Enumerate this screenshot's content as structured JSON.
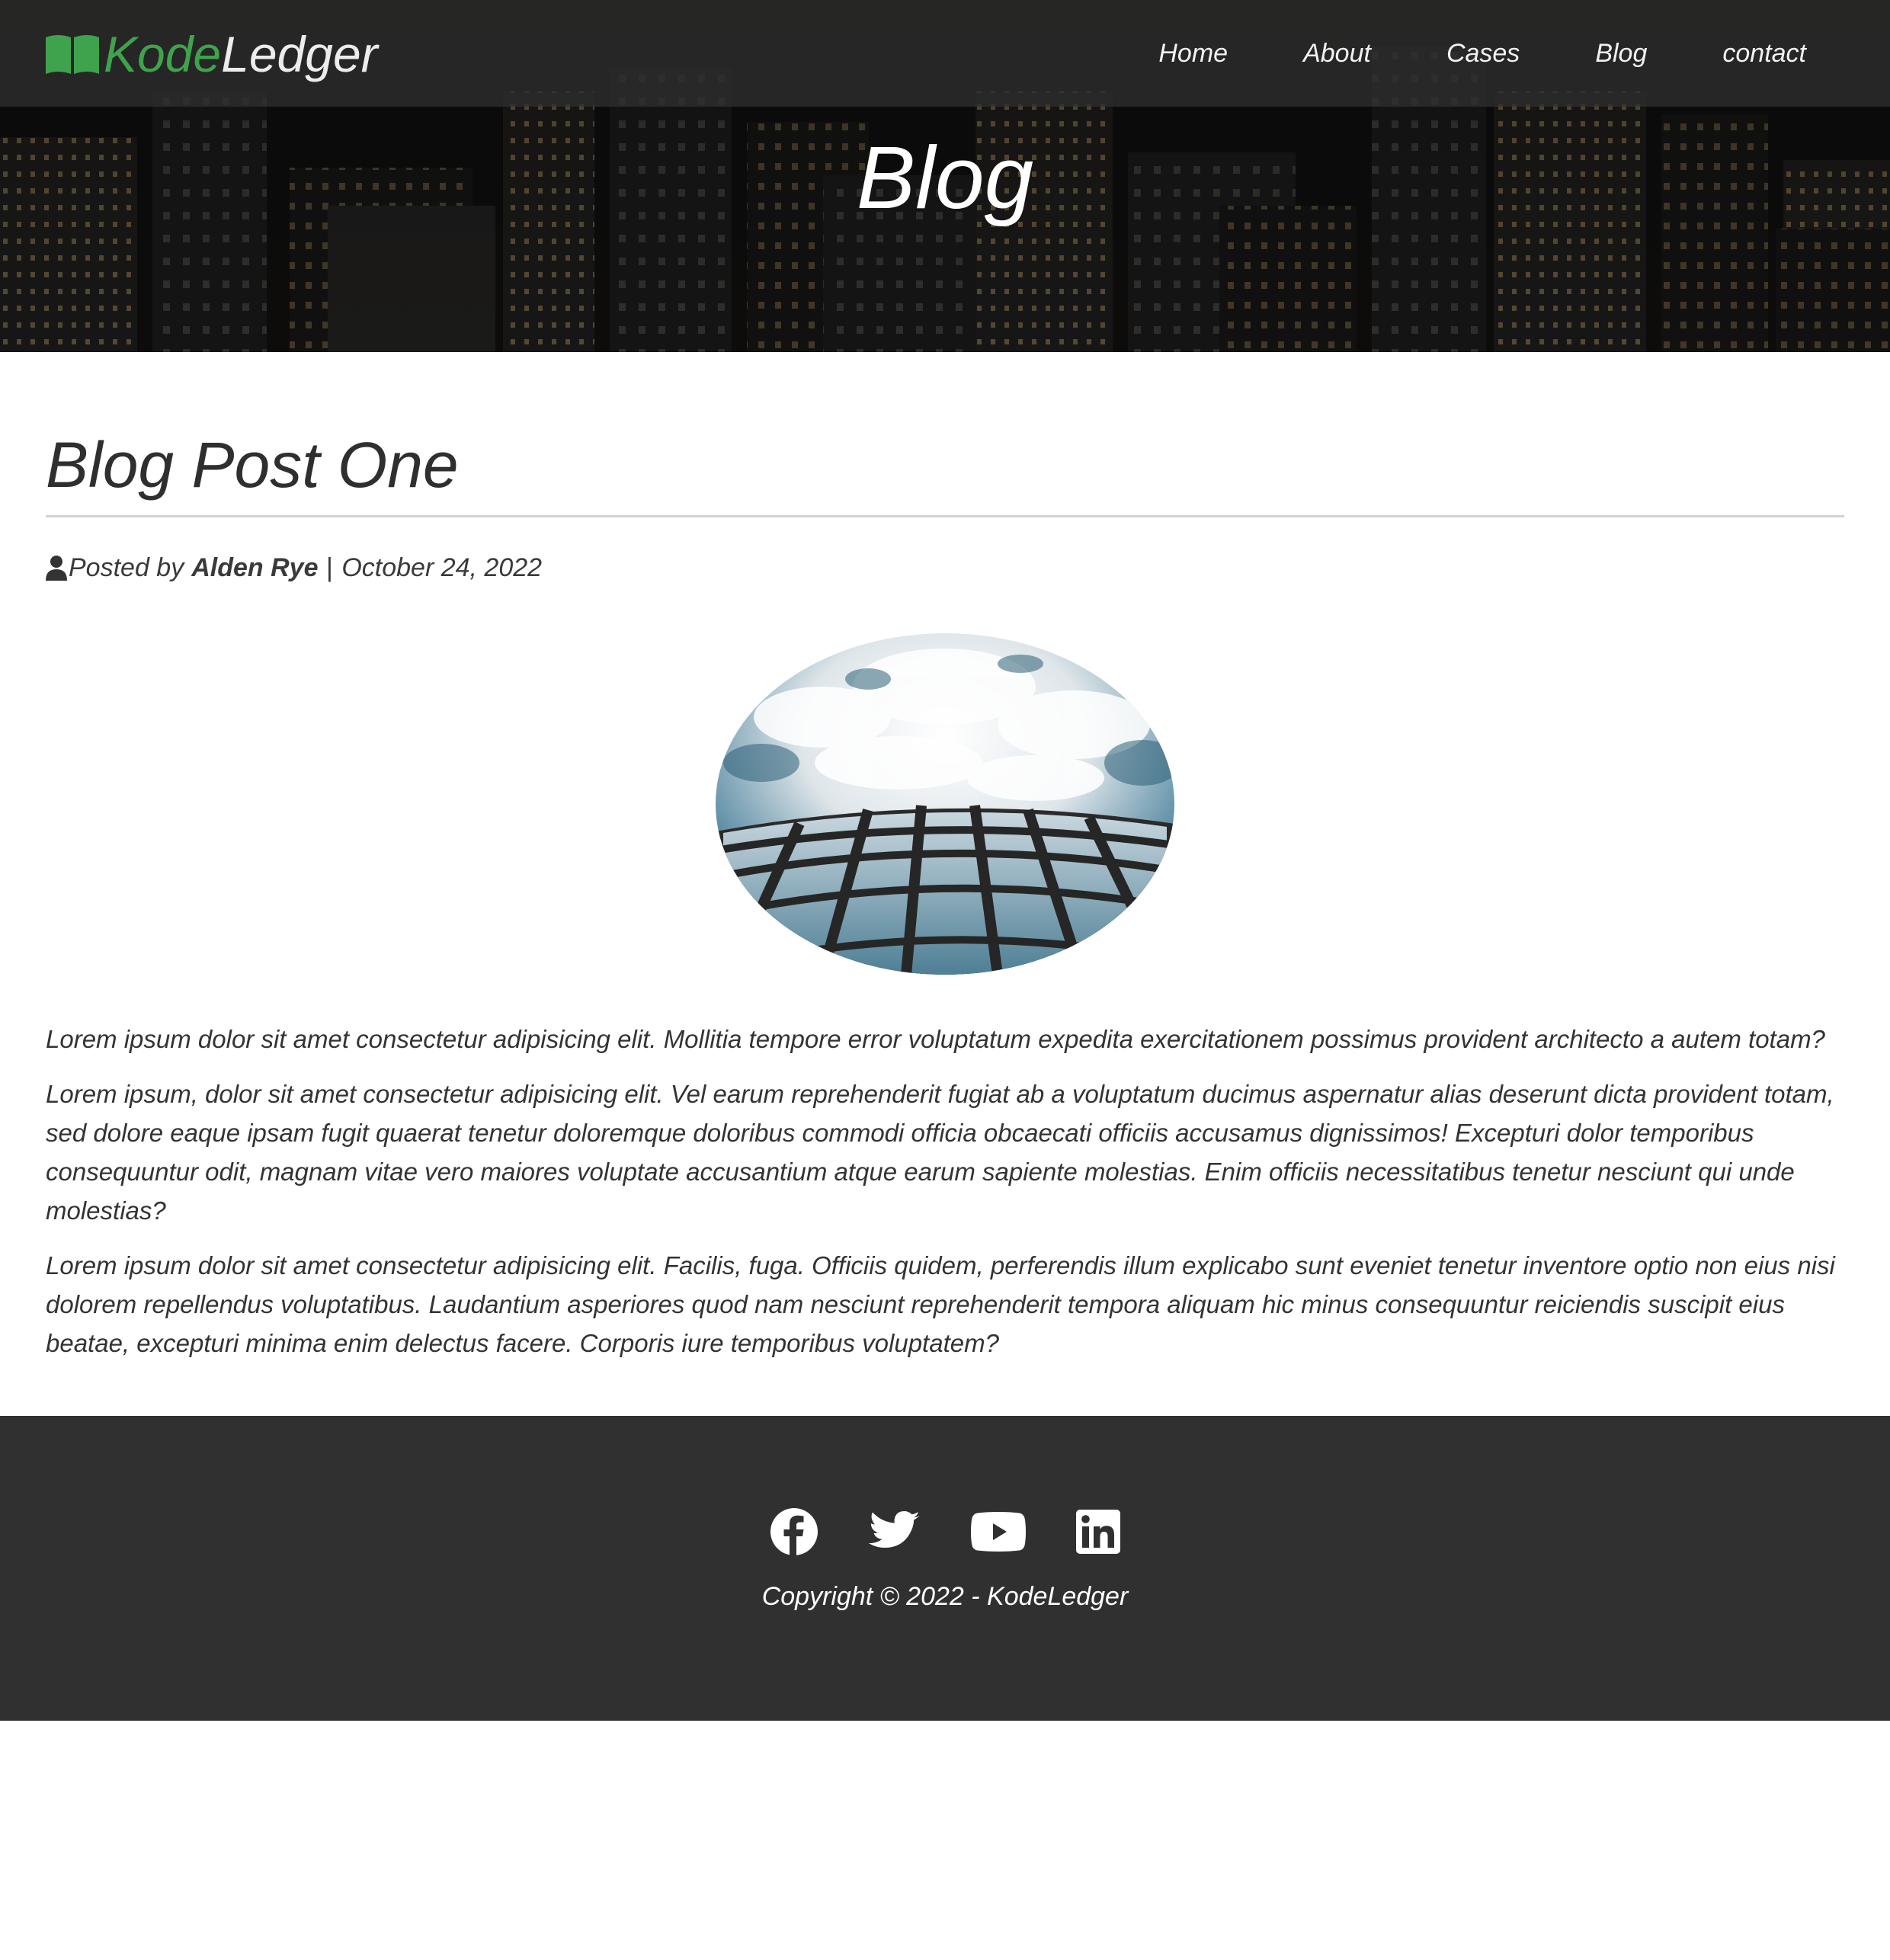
{
  "brand": {
    "icon": "open-book-icon",
    "name_part1": "Kode",
    "name_part2": "Ledger",
    "accent_color": "#3fa34d"
  },
  "nav": {
    "items": [
      {
        "label": "Home"
      },
      {
        "label": "About"
      },
      {
        "label": "Cases"
      },
      {
        "label": "Blog"
      },
      {
        "label": "contact"
      }
    ]
  },
  "hero": {
    "title": "Blog",
    "background": "night city skyline photo"
  },
  "post": {
    "title": "Blog Post One",
    "meta": {
      "icon": "user-icon",
      "posted_by": "Posted by",
      "author": "Alden Rye",
      "separator": "|",
      "date": "October 24, 2022"
    },
    "image": "skyscraper-reflecting-sky photo",
    "paragraphs": [
      "Lorem ipsum dolor sit amet consectetur adipisicing elit. Mollitia tempore error voluptatum expedita exercitationem possimus provident architecto a autem totam?",
      "Lorem ipsum, dolor sit amet consectetur adipisicing elit. Vel earum reprehenderit fugiat ab a voluptatum ducimus aspernatur alias deserunt dicta provident totam, sed dolore eaque ipsam fugit quaerat tenetur doloremque doloribus commodi officia obcaecati officiis accusamus dignissimos! Excepturi dolor temporibus consequuntur odit, magnam vitae vero maiores voluptate accusantium atque earum sapiente molestias. Enim officiis necessitatibus tenetur nesciunt qui unde molestias?",
      "Lorem ipsum dolor sit amet consectetur adipisicing elit. Facilis, fuga. Officiis quidem, perferendis illum explicabo sunt eveniet tenetur inventore optio non eius nisi dolorem repellendus voluptatibus. Laudantium asperiores quod nam nesciunt reprehenderit tempora aliquam hic minus consequuntur reiciendis suscipit eius beatae, excepturi minima enim delectus facere. Corporis iure temporibus voluptatem?"
    ]
  },
  "footer": {
    "social": [
      "facebook-icon",
      "twitter-icon",
      "youtube-icon",
      "linkedin-icon"
    ],
    "copyright": "Copyright © 2022 - KodeLedger",
    "background_color": "#303030"
  }
}
